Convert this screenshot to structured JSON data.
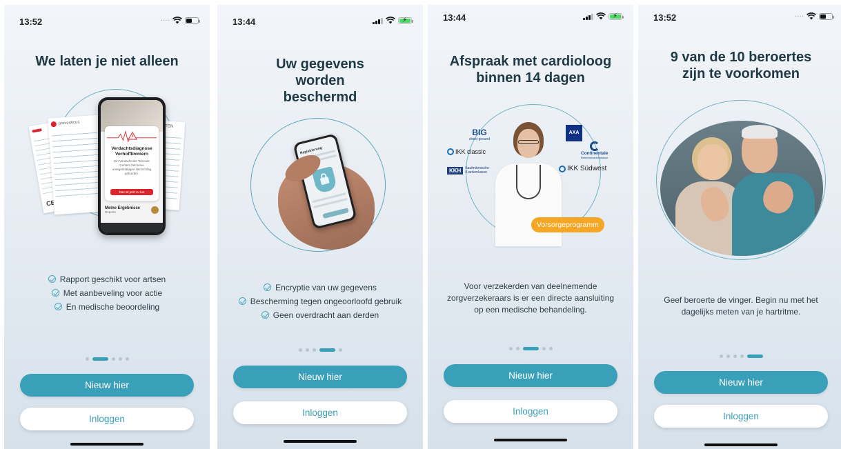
{
  "screens": [
    {
      "time": "13:52",
      "title": "We laten je niet alleen",
      "features": [
        "Rapport geschikt voor artsen",
        "Met aanbeveling voor actie",
        "En medische beoordeling"
      ],
      "app_card": {
        "diagnosis": "Verdachtsdiagnose Vorhofflimmern",
        "note": "Ein Verdacht der Telecare Centers hat keine unregelmäßigen Herzschlag gefunden.",
        "cta": "Das ist jetzt zu tun",
        "results": "Meine Ergebnisse",
        "results_sub": "Reports",
        "report_brand": "preventicus",
        "report_header": "RAPPORTEN",
        "ce": "CE"
      },
      "page_index": 1,
      "primary_button": "Nieuw hier",
      "secondary_button": "Inloggen"
    },
    {
      "time": "13:44",
      "title": "Uw gegevens worden beschermd",
      "features": [
        "Encryptie van uw gegevens",
        "Bescherming tegen ongeoorloofd gebruik",
        "Geen overdracht aan derden"
      ],
      "phone_screen_title": "Registrierung",
      "page_index": 3,
      "primary_button": "Nieuw hier",
      "secondary_button": "Inloggen"
    },
    {
      "time": "13:44",
      "title": "Afspraak met cardioloog binnen 14 dagen",
      "insurers": {
        "big": "BIG",
        "big_sub": "direkt gesund",
        "ikk_classic": "IKK classic",
        "kkh": "KKH",
        "kkh_sub": "Kaufmännische Krankenkasse",
        "axa": "AXA",
        "continentale": "Continentale",
        "continentale_sub": "Betriebskrankenkasse",
        "ikk_sudwest": "IKK Südwest"
      },
      "badge": "Vorsorgeprogramm",
      "body": "Voor verzekerden van deelnemende zorgverzekeraars is er een directe aansluiting op een medische behandeling.",
      "page_index": 2,
      "primary_button": "Nieuw hier",
      "secondary_button": "Inloggen"
    },
    {
      "time": "13:52",
      "title": "9 van de 10 beroertes zijn te voorkomen",
      "body": "Geef beroerte de vinger. Begin nu met het dagelijks meten van je hartritme.",
      "page_index": 4,
      "primary_button": "Nieuw hier",
      "secondary_button": "Inloggen"
    }
  ],
  "page_count": 5,
  "colors": {
    "accent": "#3a9fb8",
    "title": "#1f3a45",
    "badge": "#f5a623",
    "alert": "#d9262c"
  }
}
